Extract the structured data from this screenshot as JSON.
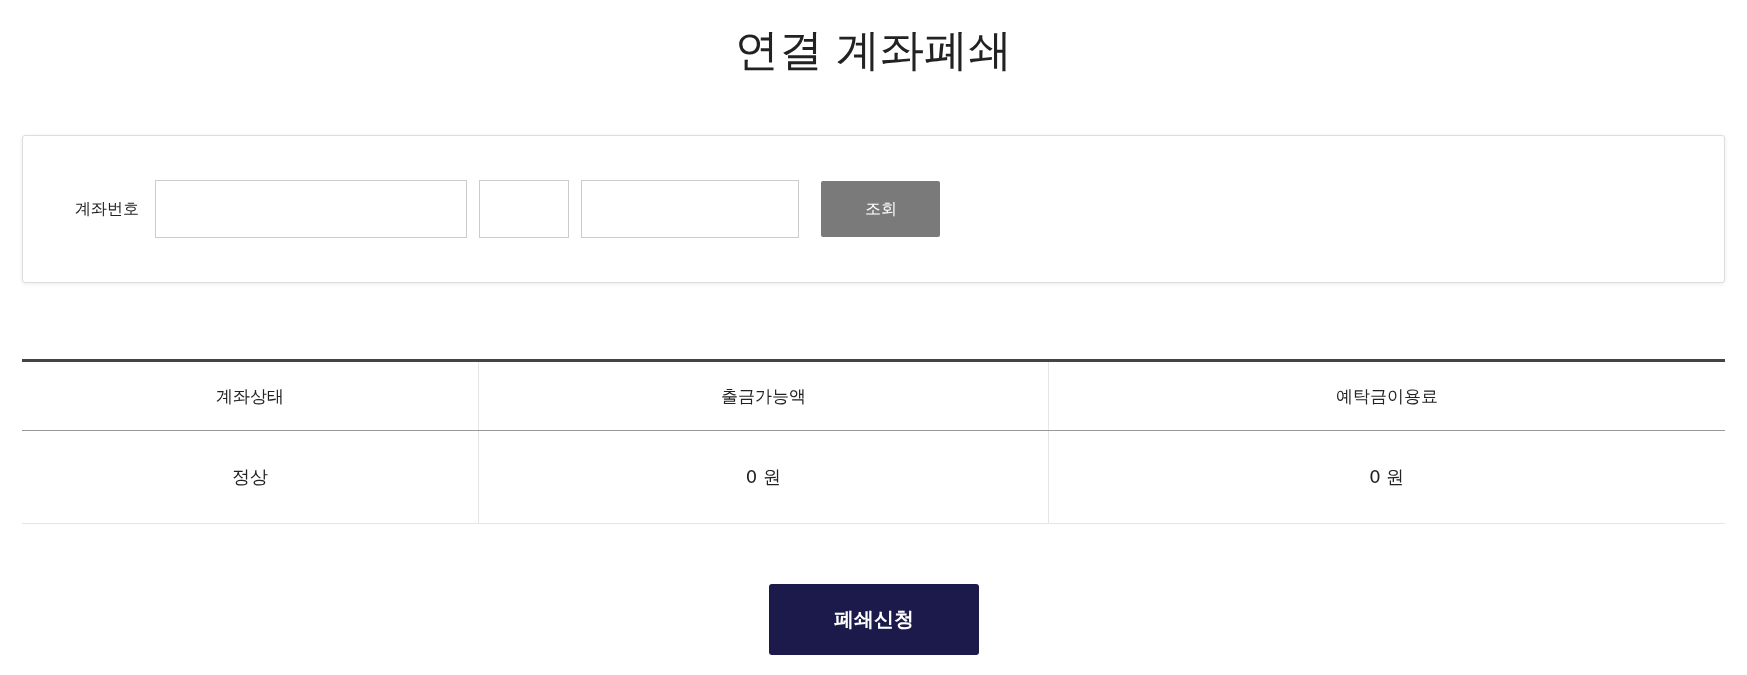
{
  "title": "연결 계좌폐쇄",
  "search": {
    "label": "계좌번호",
    "fields": [
      {
        "kind": "wide"
      },
      {
        "kind": "narrow"
      },
      {
        "kind": "medium"
      }
    ],
    "button": "조회"
  },
  "table": {
    "columns": [
      "계좌상태",
      "출금가능액",
      "예탁금이용료"
    ],
    "rows": [
      [
        "정상",
        "0 원",
        "0 원"
      ]
    ]
  },
  "submit": "폐쇄신청"
}
